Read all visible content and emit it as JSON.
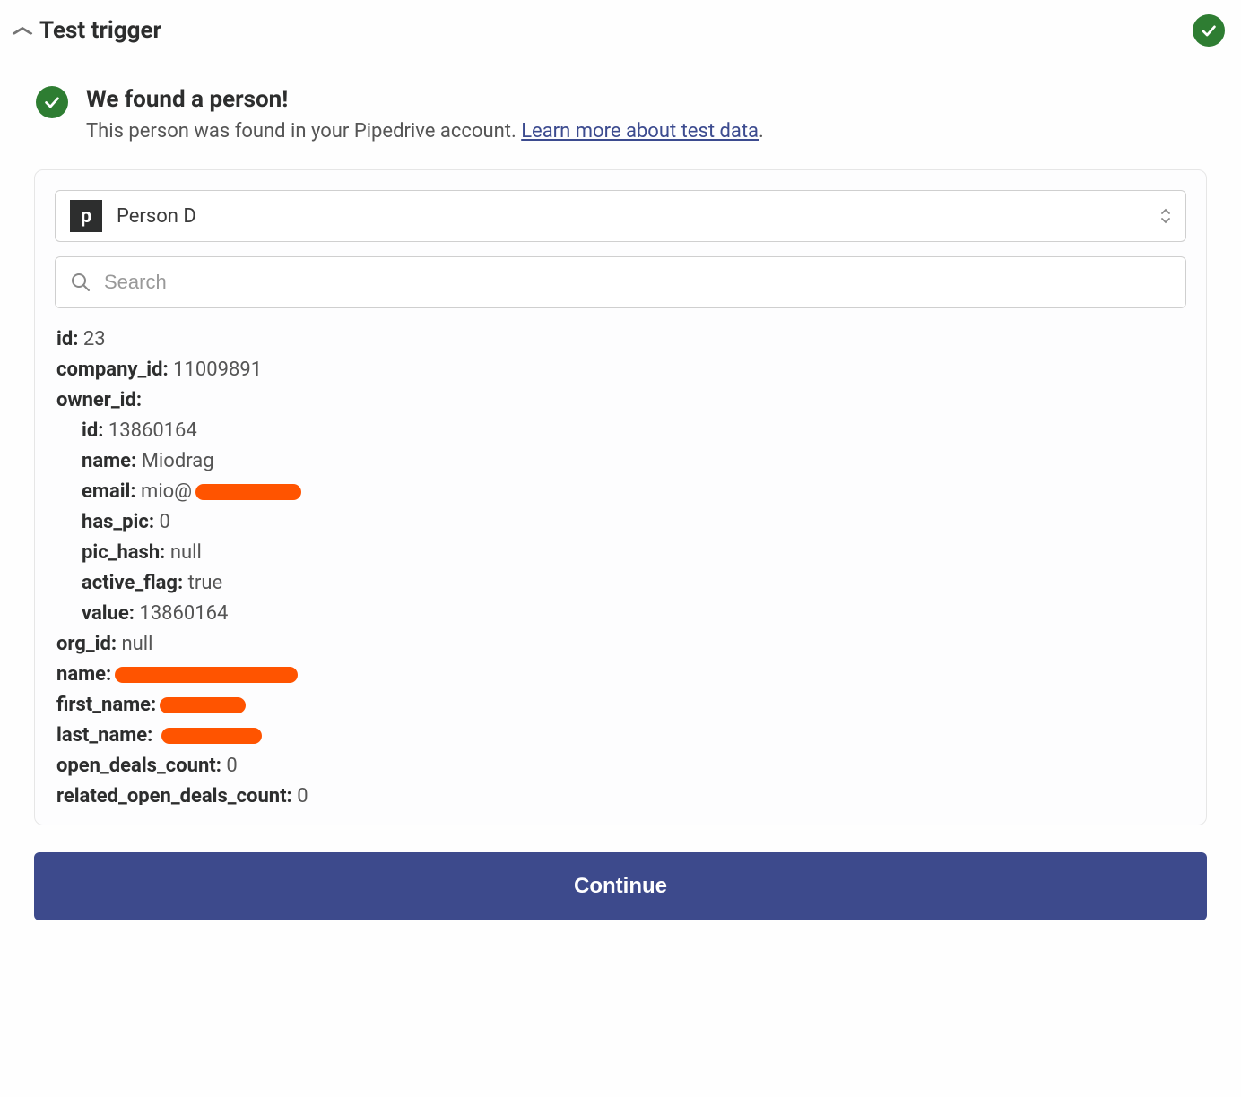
{
  "header": {
    "title": "Test trigger"
  },
  "found": {
    "heading": "We found a person!",
    "subtext_prefix": "This person was found in your Pipedrive account. ",
    "link_text": "Learn more about test data",
    "subtext_suffix": "."
  },
  "selector": {
    "logo_letter": "p",
    "selected": "Person D"
  },
  "search": {
    "placeholder": "Search"
  },
  "record": {
    "id_key": "id:",
    "id_val": "23",
    "company_id_key": "company_id:",
    "company_id_val": "11009891",
    "owner_id_key": "owner_id:",
    "owner": {
      "id_key": "id:",
      "id_val": "13860164",
      "name_key": "name:",
      "name_val": "Miodrag",
      "email_key": "email:",
      "email_val": "mio@",
      "has_pic_key": "has_pic:",
      "has_pic_val": "0",
      "pic_hash_key": "pic_hash:",
      "pic_hash_val": "null",
      "active_flag_key": "active_flag:",
      "active_flag_val": "true",
      "value_key": "value:",
      "value_val": "13860164"
    },
    "org_id_key": "org_id:",
    "org_id_val": "null",
    "name_key": "name:",
    "first_name_key": "first_name:",
    "last_name_key": "last_name:",
    "open_deals_key": "open_deals_count:",
    "open_deals_val": "0",
    "related_open_deals_key": "related_open_deals_count:",
    "related_open_deals_val": "0"
  },
  "button": {
    "continue": "Continue"
  }
}
